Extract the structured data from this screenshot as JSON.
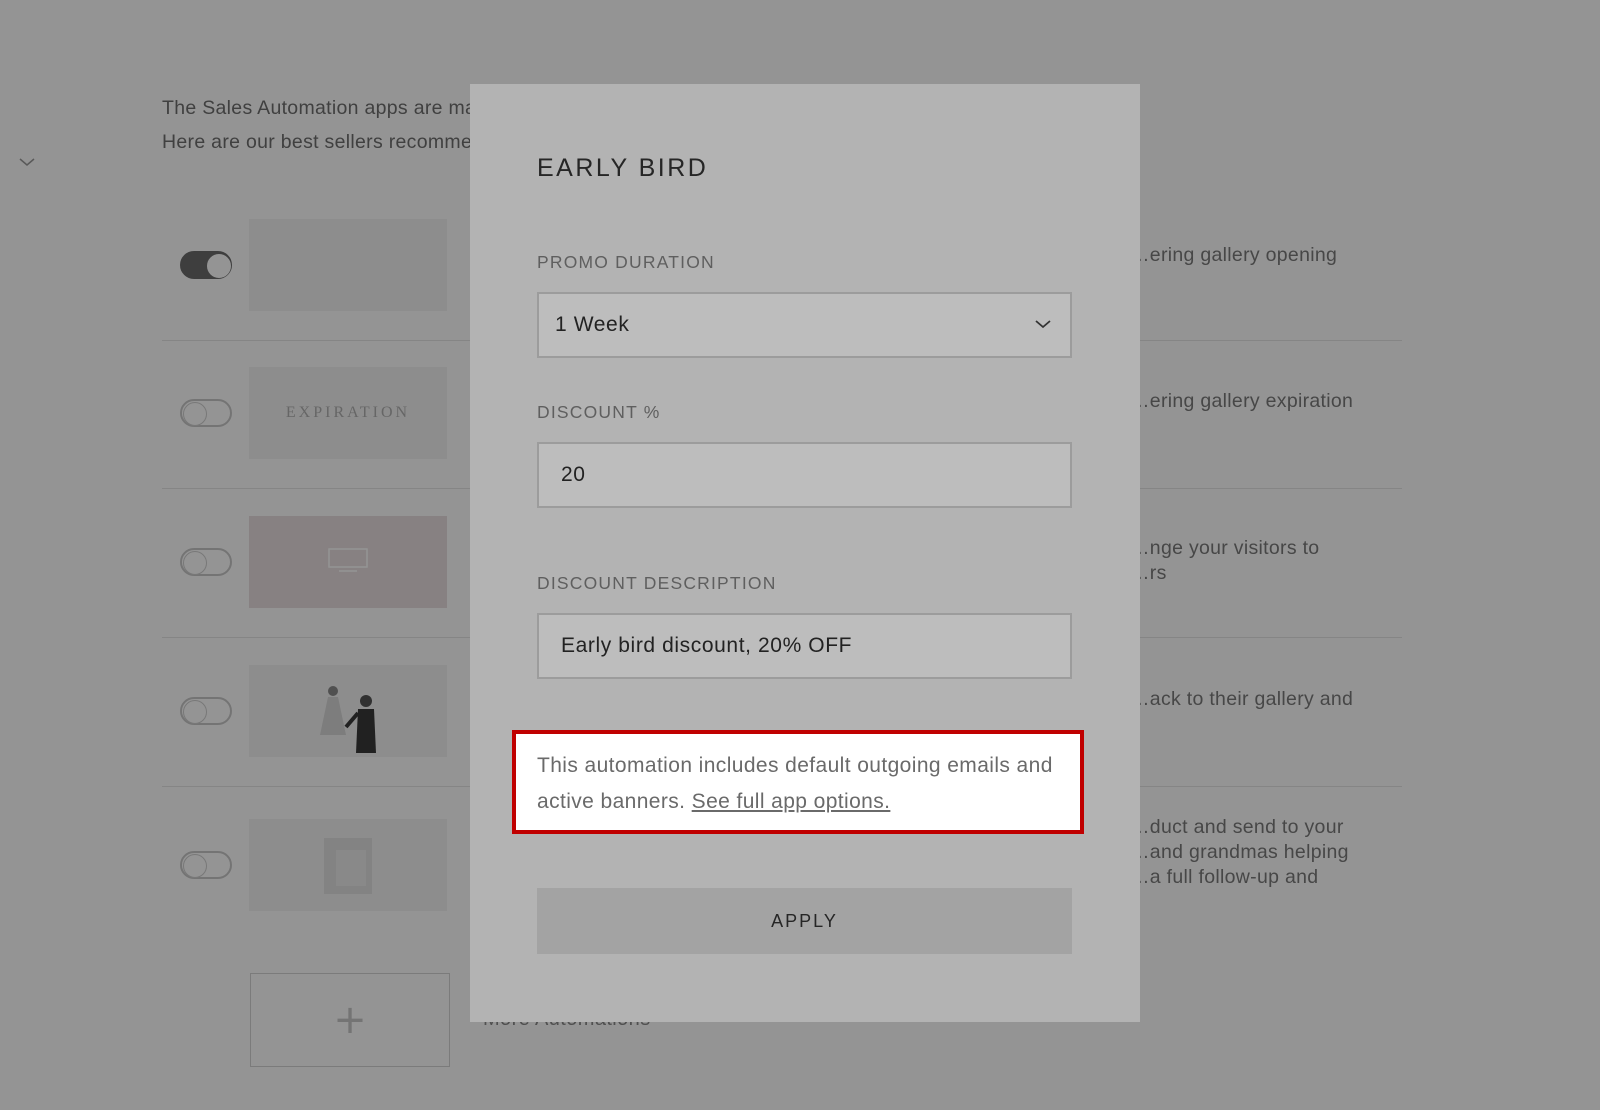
{
  "background": {
    "intro_lines": [
      "The Sales Automation apps are made to help you save time and increase your sales.",
      "Here are our best sellers recommended for you"
    ],
    "apps": [
      {
        "enabled": true,
        "thumb_label": "",
        "description": "…ering gallery opening"
      },
      {
        "enabled": false,
        "thumb_label": "EXPIRATION",
        "description": "…ering gallery expiration"
      },
      {
        "enabled": false,
        "thumb_label": "",
        "description_lines": [
          "…nge your visitors to",
          "…rs"
        ]
      },
      {
        "enabled": false,
        "thumb_label": "",
        "description": "…ack to their gallery and"
      },
      {
        "enabled": false,
        "thumb_label": "",
        "description_lines": [
          "…duct and send to your",
          "…and grandmas helping",
          "…a full follow-up and"
        ]
      }
    ],
    "more_label": "More Automations",
    "more_icon": "plus-icon"
  },
  "modal": {
    "title": "EARLY BIRD",
    "promo_duration": {
      "label": "PROMO DURATION",
      "value": "1 Week",
      "icon": "chevron-down-icon"
    },
    "discount": {
      "label": "DISCOUNT %",
      "value": "20"
    },
    "discount_description": {
      "label": "DISCOUNT DESCRIPTION",
      "value": "Early bird discount, 20% OFF"
    },
    "note": {
      "text": "This automation includes default outgoing emails and active banners.",
      "link": "See full app options."
    },
    "apply_label": "APPLY"
  },
  "colors": {
    "highlight_border": "#c00000",
    "overlay": "rgba(0,0,0,0.42)"
  }
}
